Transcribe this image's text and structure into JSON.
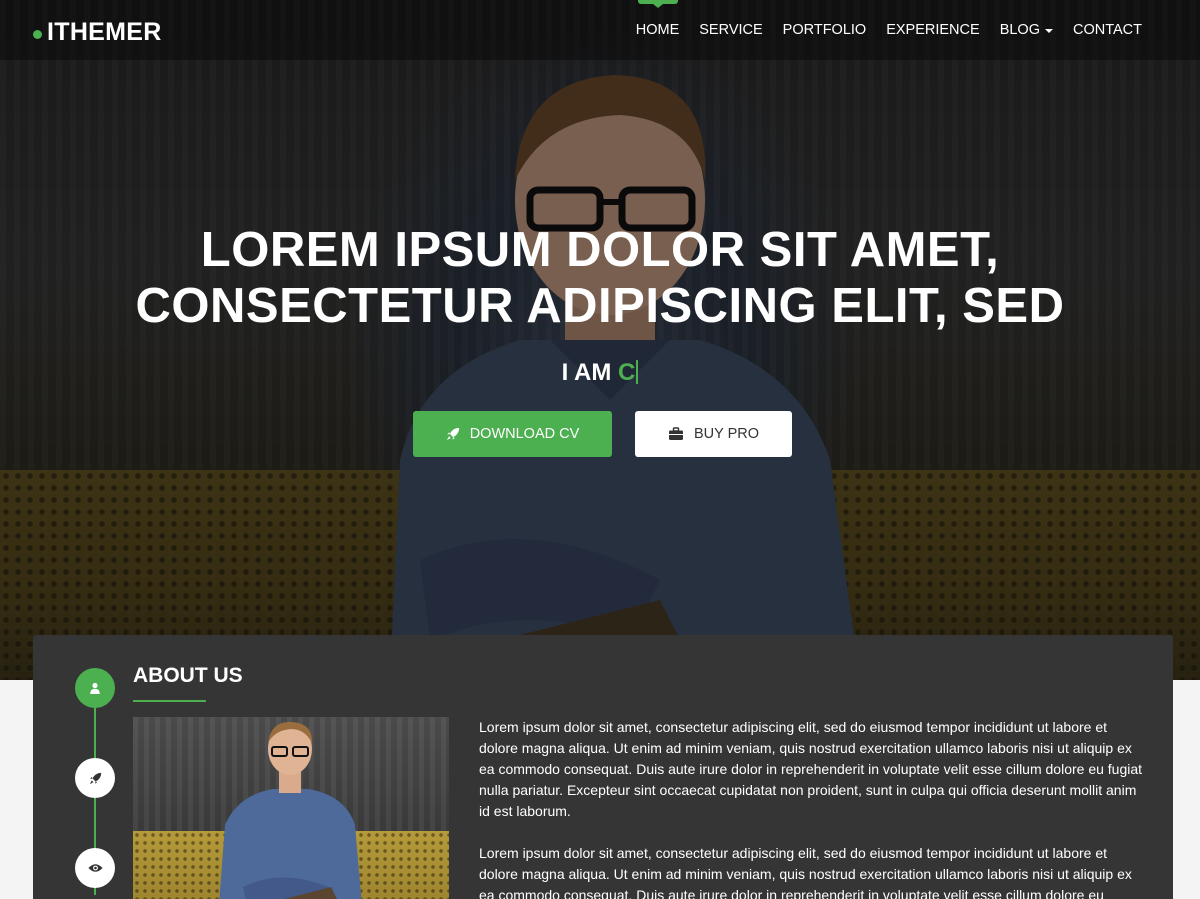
{
  "brand": {
    "name": "ITHEMER",
    "accent": "#4caf50"
  },
  "nav": {
    "items": [
      {
        "label": "HOME",
        "active": true
      },
      {
        "label": "SERVICE"
      },
      {
        "label": "PORTFOLIO"
      },
      {
        "label": "EXPERIENCE"
      },
      {
        "label": "BLOG",
        "dropdown": true
      },
      {
        "label": "CONTACT"
      }
    ]
  },
  "hero": {
    "title_line1": "LOREM IPSUM DOLOR SIT AMET,",
    "title_line2": "CONSECTETUR ADIPISCING ELIT, SED",
    "subtitle_prefix": "I AM",
    "typed_text": "C",
    "download_label": "DOWNLOAD CV",
    "download_icon": "rocket-icon",
    "buy_label": "BUY PRO",
    "buy_icon": "briefcase-icon"
  },
  "about": {
    "title": "ABOUT US",
    "timeline_icons": [
      "user-icon",
      "rocket-icon",
      "eye-icon"
    ],
    "paragraph1": "Lorem ipsum dolor sit amet, consectetur adipiscing elit, sed do eiusmod tempor incididunt ut labore et dolore magna aliqua. Ut enim ad minim veniam, quis nostrud exercitation ullamco laboris nisi ut aliquip ex ea commodo consequat. Duis aute irure dolor in reprehenderit in voluptate velit esse cillum dolore eu fugiat nulla pariatur. Excepteur sint occaecat cupidatat non proident, sunt in culpa qui officia deserunt mollit anim id est laborum.",
    "paragraph2": "Lorem ipsum dolor sit amet, consectetur adipiscing elit, sed do eiusmod tempor incididunt ut labore et dolore magna aliqua. Ut enim ad minim veniam, quis nostrud exercitation ullamco laboris nisi ut aliquip ex ea commodo consequat. Duis aute irure dolor in reprehenderit in voluptate velit esse cillum dolore eu"
  }
}
